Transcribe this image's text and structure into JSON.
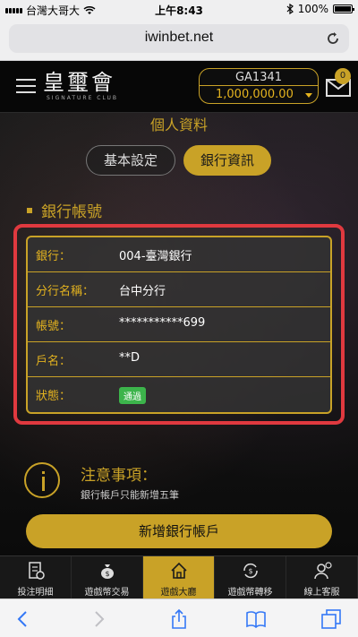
{
  "status_bar": {
    "carrier": "台灣大哥大",
    "time": "上午8:43",
    "battery": "100%"
  },
  "browser": {
    "url": "iwinbet.net"
  },
  "header": {
    "logo_text": "皇璽會",
    "logo_subtext": "SIGNATURE CLUB",
    "account_id": "GA1341",
    "balance": "1,000,000.00",
    "mail_count": "0"
  },
  "page": {
    "title": "個人資料",
    "tabs": [
      {
        "label": "基本設定",
        "active": false
      },
      {
        "label": "銀行資訊",
        "active": true
      }
    ],
    "section_title": "銀行帳號",
    "bank_info": [
      {
        "label": "銀行：",
        "value": "004-臺灣銀行"
      },
      {
        "label": "分行名稱：",
        "value": "台中分行"
      },
      {
        "label": "帳號：",
        "value": "***********699"
      },
      {
        "label": "戶名：",
        "value": "**D"
      },
      {
        "label": "狀態：",
        "value": "通過"
      }
    ],
    "notice_title": "注意事項：",
    "notice_text": "銀行帳戶只能新增五筆",
    "add_button": "新增銀行帳戶"
  },
  "bottom_nav": [
    {
      "label": "投注明細",
      "icon": "receipt-icon"
    },
    {
      "label": "遊戲幣交易",
      "icon": "money-bag-icon"
    },
    {
      "label": "遊戲大廳",
      "icon": "home-icon",
      "active": true
    },
    {
      "label": "遊戲幣轉移",
      "icon": "transfer-icon"
    },
    {
      "label": "線上客服",
      "icon": "customer-service-icon"
    }
  ],
  "colors": {
    "gold": "#c9a227",
    "highlight_red": "#e0393f",
    "approved_green": "#3cb44b"
  }
}
